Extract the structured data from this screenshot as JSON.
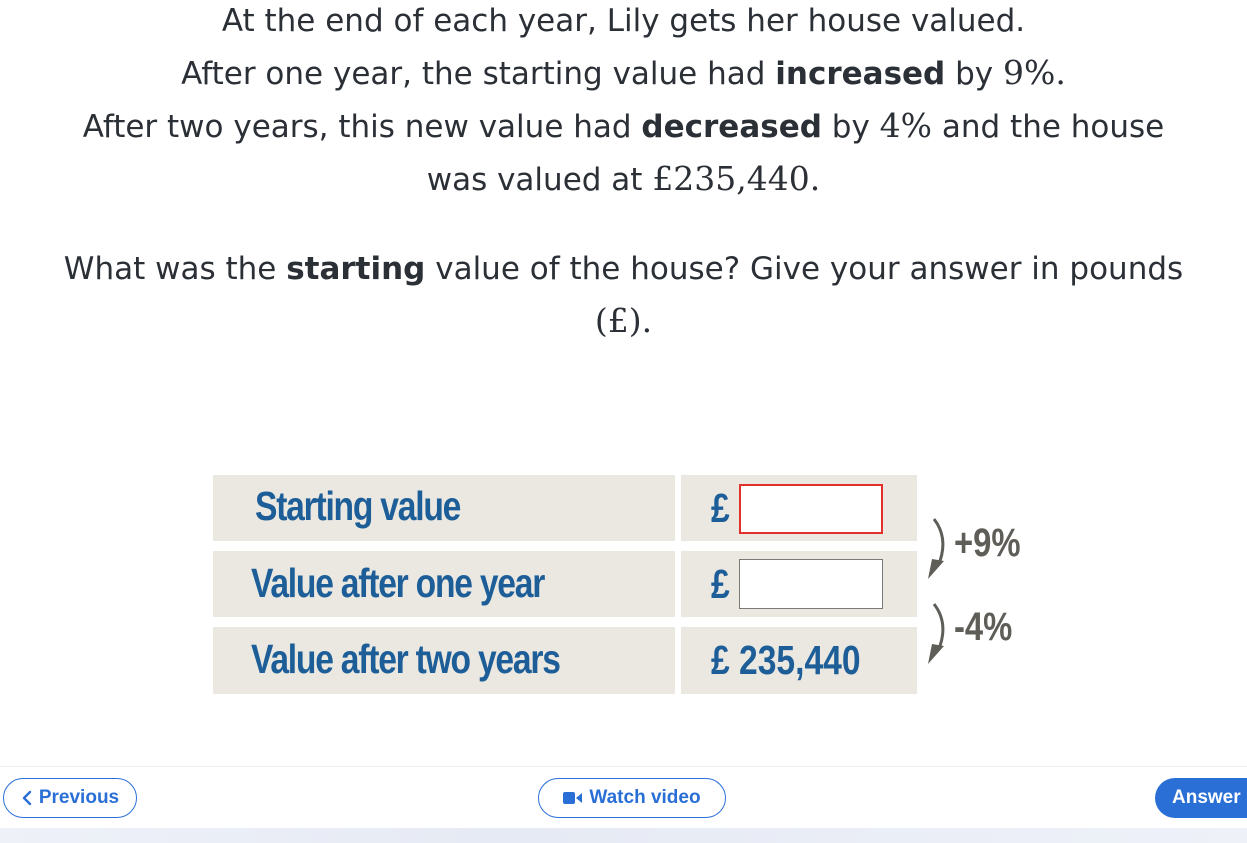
{
  "question": {
    "line1": "At the end of each year, Lily gets her house valued.",
    "line2_pre": "After one year, the starting value had ",
    "line2_bold": "increased",
    "line2_post": " by ",
    "line2_math": "9%.",
    "line3_pre": "After two years, this new value had ",
    "line3_bold": "decreased",
    "line3_post": " by ",
    "line3_math": "4%",
    "line3_end": " and the house",
    "line4_pre": "was valued at ",
    "line4_math": "£235,440.",
    "prompt_pre": "What was the ",
    "prompt_bold": "starting",
    "prompt_post": " value of the house? Give your answer in pounds",
    "prompt_math": "(£)."
  },
  "table": {
    "rows": [
      {
        "label": "Starting value",
        "currency": "£",
        "value": ""
      },
      {
        "label": "Value after one year",
        "currency": "£",
        "value": ""
      },
      {
        "label": "Value after two years",
        "currency": "£",
        "value": "235,440"
      }
    ],
    "value_two_years_text": "£ 235,440",
    "change1": "+9%",
    "change2": "-4%"
  },
  "footer": {
    "previous_label": "Previous",
    "video_label": "Watch video",
    "answer_label": "Answer"
  },
  "colors": {
    "accent": "#2a6fd6",
    "label_blue": "#1d5e98",
    "cell_bg": "#ebe8e1",
    "active_border": "#e2302d"
  }
}
